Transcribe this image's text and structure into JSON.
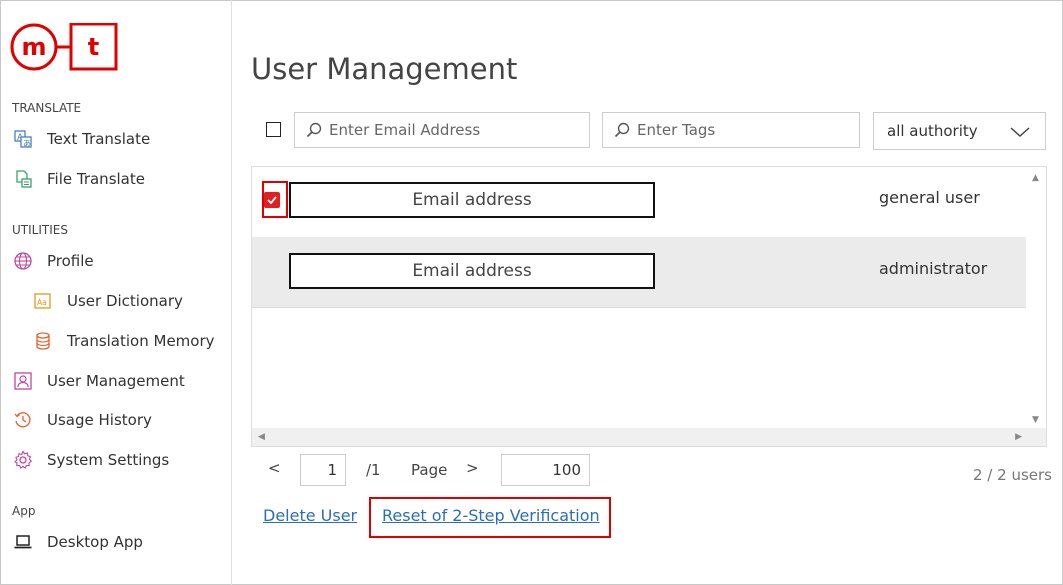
{
  "logo": {
    "left_letter": "m",
    "right_letter": "t"
  },
  "sidebar": {
    "sections": {
      "translate": "TRANSLATE",
      "utilities": "UTILITIES",
      "app": "App"
    },
    "items": [
      {
        "label": "Text Translate",
        "icon": "text-translate-icon"
      },
      {
        "label": "File Translate",
        "icon": "file-translate-icon"
      },
      {
        "label": "Profile",
        "icon": "globe-icon"
      },
      {
        "label": "User Dictionary",
        "icon": "dictionary-icon"
      },
      {
        "label": "Translation Memory",
        "icon": "database-icon"
      },
      {
        "label": "User Management",
        "icon": "user-icon"
      },
      {
        "label": "Usage History",
        "icon": "history-icon"
      },
      {
        "label": "System Settings",
        "icon": "gear-icon"
      },
      {
        "label": "Desktop App",
        "icon": "laptop-icon"
      }
    ]
  },
  "main": {
    "title": "User Management",
    "filters": {
      "email_placeholder": "Enter Email Address",
      "tags_placeholder": "Enter Tags",
      "authority_selected": "all authority"
    },
    "users": [
      {
        "email": "Email address",
        "role": "general user",
        "checked": true
      },
      {
        "email": "Email address",
        "role": "administrator",
        "checked": false
      }
    ],
    "pagination": {
      "prev": "<",
      "page": "1",
      "total": "/1",
      "page_label": "Page",
      "next": ">",
      "per_page": "100",
      "count": "2 / 2 users"
    },
    "actions": {
      "delete": "Delete User",
      "reset_2fa": "Reset of 2-Step Verification"
    }
  },
  "colors": {
    "brand_red": "#e00000",
    "link": "#2a6ebb",
    "alt_row": "#ebebeb"
  }
}
